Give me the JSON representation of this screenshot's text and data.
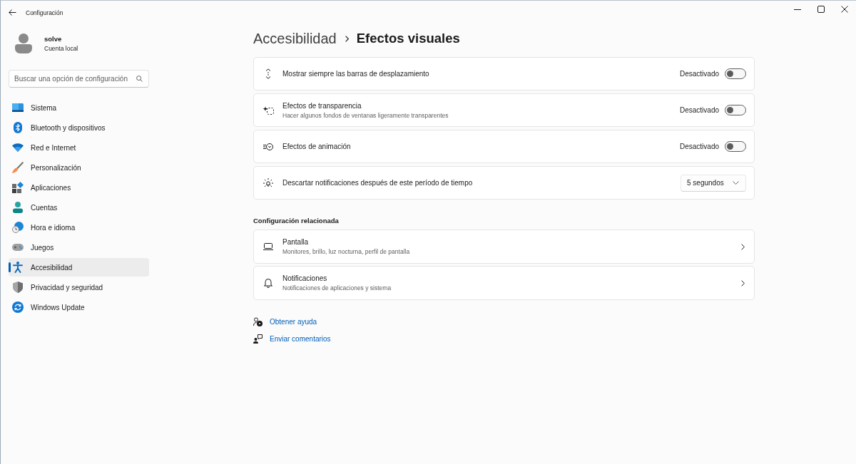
{
  "window": {
    "title": "Configuración"
  },
  "user": {
    "name": "solve",
    "account": "Cuenta local"
  },
  "search": {
    "placeholder": "Buscar una opción de configuración"
  },
  "sidebar": {
    "items": [
      {
        "label": "Sistema",
        "selected": false
      },
      {
        "label": "Bluetooth y dispositivos",
        "selected": false
      },
      {
        "label": "Red e Internet",
        "selected": false
      },
      {
        "label": "Personalización",
        "selected": false
      },
      {
        "label": "Aplicaciones",
        "selected": false
      },
      {
        "label": "Cuentas",
        "selected": false
      },
      {
        "label": "Hora e idioma",
        "selected": false
      },
      {
        "label": "Juegos",
        "selected": false
      },
      {
        "label": "Accesibilidad",
        "selected": true
      },
      {
        "label": "Privacidad y seguridad",
        "selected": false
      },
      {
        "label": "Windows Update",
        "selected": false
      }
    ]
  },
  "breadcrumb": {
    "parent": "Accesibilidad",
    "current": "Efectos visuales"
  },
  "settings": [
    {
      "kind": "toggle",
      "label": "Mostrar siempre las barras de desplazamiento",
      "state_label": "Desactivado",
      "on": false
    },
    {
      "kind": "toggle",
      "label": "Efectos de transparencia",
      "description": "Hacer algunos fondos de ventanas ligeramente transparentes",
      "state_label": "Desactivado",
      "on": false
    },
    {
      "kind": "toggle",
      "label": "Efectos de animación",
      "state_label": "Desactivado",
      "on": false
    },
    {
      "kind": "dropdown",
      "label": "Descartar notificaciones después de este período de tiempo",
      "value": "5 segundos"
    }
  ],
  "related": {
    "heading": "Configuración relacionada",
    "items": [
      {
        "label": "Pantalla",
        "description": "Monitores, brillo, luz nocturna, perfil de pantalla"
      },
      {
        "label": "Notificaciones",
        "description": "Notificaciones de aplicaciones y sistema"
      }
    ]
  },
  "links": [
    {
      "label": "Obtener ayuda"
    },
    {
      "label": "Enviar comentarios"
    }
  ]
}
